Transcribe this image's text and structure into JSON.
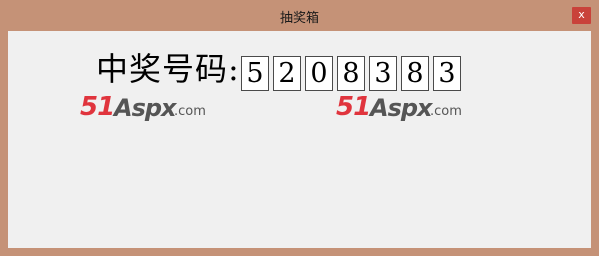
{
  "window": {
    "title": "抽奖箱",
    "close_label": "x"
  },
  "main": {
    "prize_label": "中奖号码:",
    "digits": [
      "5",
      "2",
      "0",
      "8",
      "3",
      "8",
      "3"
    ]
  },
  "logos": [
    {
      "prefix": "51",
      "brand": "Aspx",
      "suffix": ".com"
    },
    {
      "prefix": "51",
      "brand": "Aspx",
      "suffix": ".com"
    }
  ],
  "colors": {
    "window_frame": "#c59277",
    "client_background": "#f0f0f0",
    "close_button": "#c9423a",
    "logo_red": "#e0343d",
    "logo_gray": "#555555"
  }
}
